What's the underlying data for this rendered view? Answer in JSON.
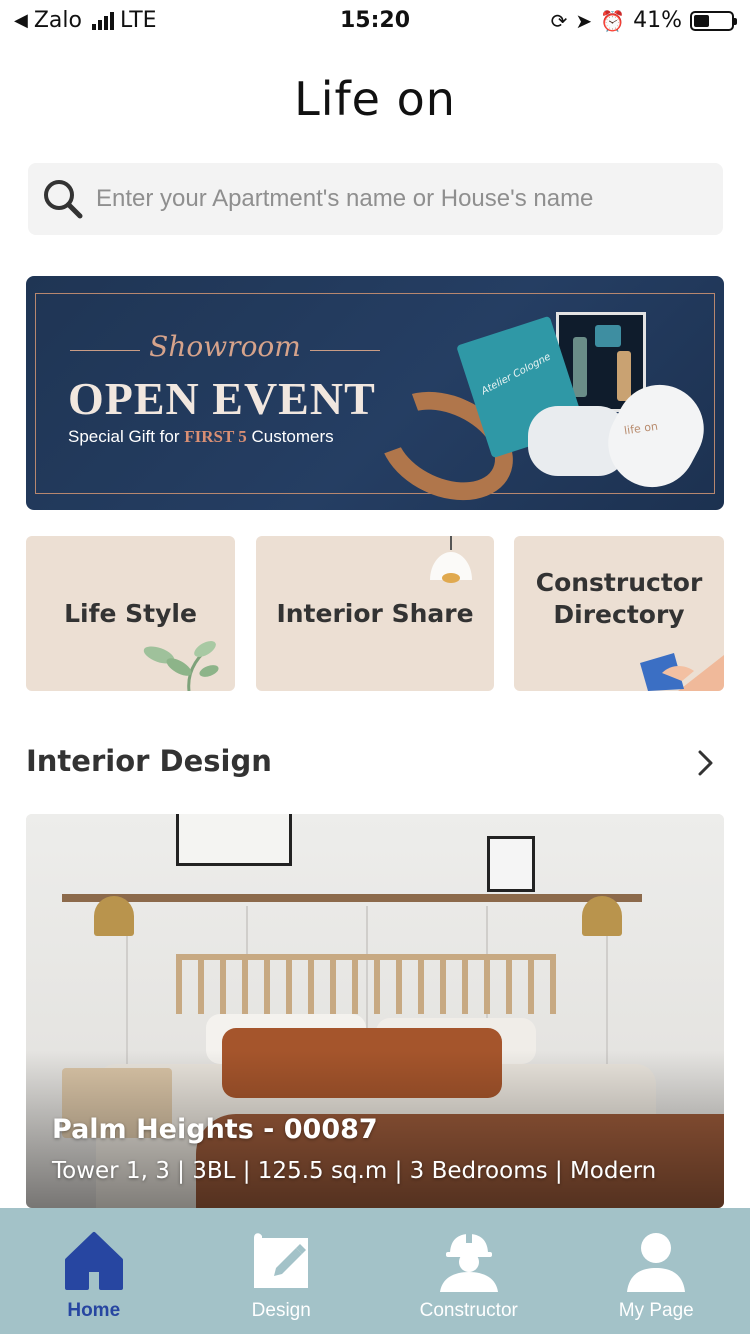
{
  "status_bar": {
    "back_app": "Zalo",
    "network": "LTE",
    "time": "15:20",
    "battery": "41%"
  },
  "header": {
    "logo": "Life on"
  },
  "search": {
    "placeholder": "Enter your Apartment's name or House's name"
  },
  "banner": {
    "kicker": "Showroom",
    "headline": "OPEN EVENT",
    "sub_prefix": "Special Gift for ",
    "sub_highlight": "FIRST 5",
    "sub_suffix": " Customers",
    "product_text": "Atelier Cologne",
    "slipper_brand": "life on"
  },
  "categories": [
    {
      "label": "Life Style"
    },
    {
      "label": "Interior Share"
    },
    {
      "label": "Constructor Directory"
    }
  ],
  "section": {
    "title": "Interior Design"
  },
  "feature_card": {
    "title": "Palm Heights - 00087",
    "meta": "Tower 1, 3 | 3BL | 125.5 sq.m | 3 Bedrooms | Modern"
  },
  "tabbar": {
    "tabs": [
      {
        "label": "Home",
        "icon": "home-icon",
        "active": true
      },
      {
        "label": "Design",
        "icon": "design-icon",
        "active": false
      },
      {
        "label": "Constructor",
        "icon": "constructor-icon",
        "active": false
      },
      {
        "label": "My Page",
        "icon": "user-icon",
        "active": false
      }
    ]
  },
  "colors": {
    "accent": "#2746a1",
    "tabbar_bg": "#a3c2c8",
    "category_bg": "#ecdfd3",
    "banner_bg": "#1f3554"
  }
}
